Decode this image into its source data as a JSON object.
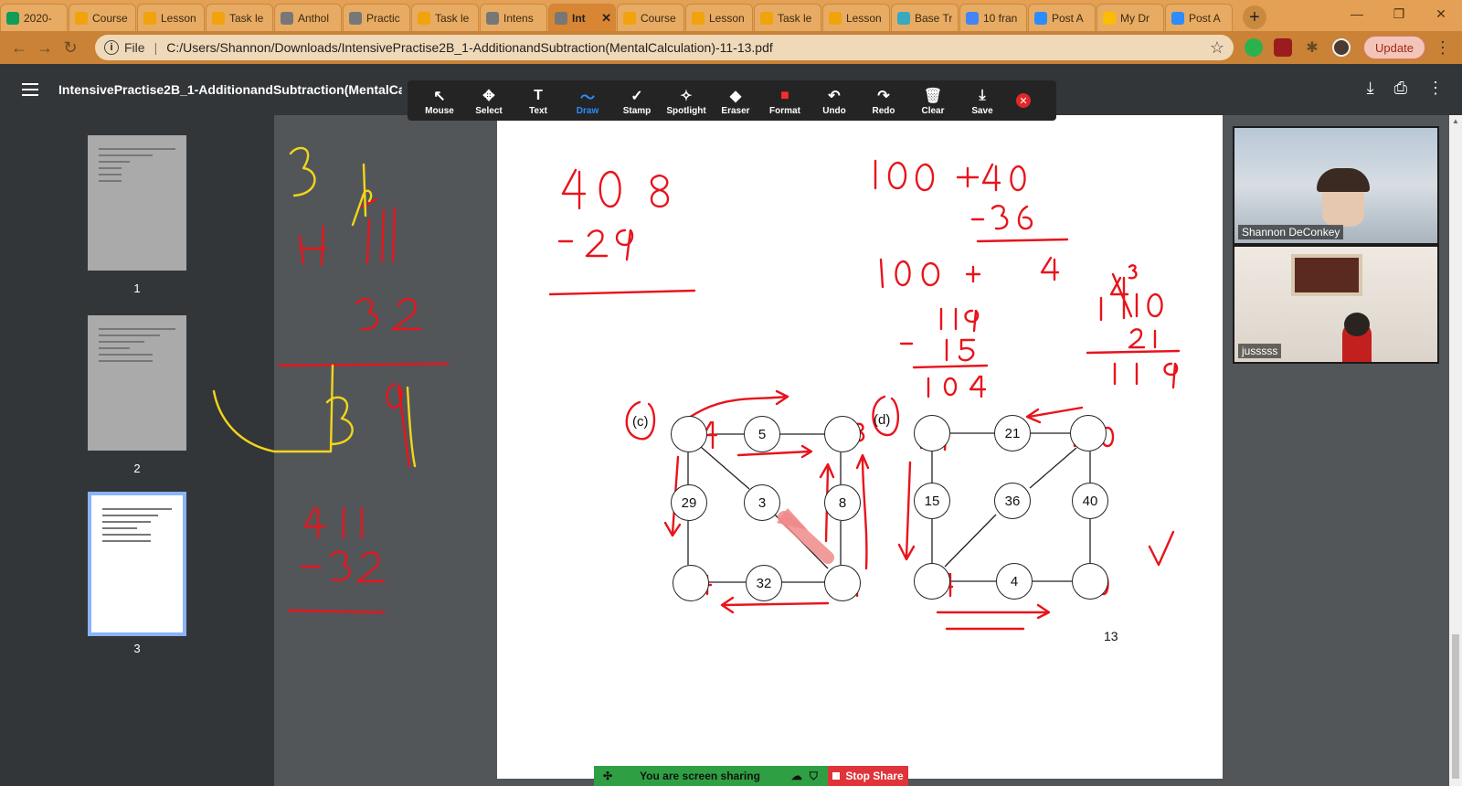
{
  "browser": {
    "tabs": [
      {
        "label": "2020-",
        "favicon": "sheets-icon",
        "color": "#0f9d58"
      },
      {
        "label": "Course",
        "favicon": "moodle-icon",
        "color": "#f0a30a"
      },
      {
        "label": "Lesson",
        "favicon": "moodle-icon",
        "color": "#f0a30a"
      },
      {
        "label": "Task le",
        "favicon": "moodle-icon",
        "color": "#f0a30a"
      },
      {
        "label": "Anthol",
        "favicon": "globe-icon",
        "color": "#777777"
      },
      {
        "label": "Practic",
        "favicon": "globe-icon",
        "color": "#777777"
      },
      {
        "label": "Task le",
        "favicon": "moodle-icon",
        "color": "#f0a30a"
      },
      {
        "label": "Intens",
        "favicon": "globe-icon",
        "color": "#777777"
      },
      {
        "label": "Int",
        "favicon": "globe-icon",
        "color": "#777777",
        "active": true
      },
      {
        "label": "Course",
        "favicon": "moodle-icon",
        "color": "#f0a30a"
      },
      {
        "label": "Lesson",
        "favicon": "moodle-icon",
        "color": "#f0a30a"
      },
      {
        "label": "Task le",
        "favicon": "moodle-icon",
        "color": "#f0a30a"
      },
      {
        "label": "Lesson",
        "favicon": "moodle-icon",
        "color": "#f0a30a"
      },
      {
        "label": "Base Tr",
        "favicon": "base-icon",
        "color": "#3aa8c1"
      },
      {
        "label": "10 fran",
        "favicon": "docs-icon",
        "color": "#4285f4"
      },
      {
        "label": "Post A",
        "favicon": "zoom-icon",
        "color": "#2d8cff"
      },
      {
        "label": "My Dr",
        "favicon": "drive-icon",
        "color": "#fbbc04"
      },
      {
        "label": "Post A",
        "favicon": "zoom-icon",
        "color": "#2d8cff"
      }
    ],
    "url_scheme": "File",
    "url": "C:/Users/Shannon/Downloads/IntensivePractise2B_1-AdditionandSubtraction(MentalCalculation)-11-13.pdf",
    "update_label": "Update"
  },
  "pdf": {
    "title": "IntensivePractise2B_1-AdditionandSubtraction(MentalCalcul",
    "thumbnails": [
      "1",
      "2",
      "3"
    ],
    "page_number": "13",
    "labels": {
      "c": "(c)",
      "d": "(d)"
    },
    "graph_c": [
      "5",
      "29",
      "3",
      "8",
      "32"
    ],
    "graph_d": [
      "21",
      "15",
      "36",
      "40",
      "4"
    ]
  },
  "annotation_toolbar": {
    "tools": [
      {
        "label": "Mouse",
        "icon": "cursor-icon",
        "glyph": "↖"
      },
      {
        "label": "Select",
        "icon": "move-icon",
        "glyph": "✥"
      },
      {
        "label": "Text",
        "icon": "text-icon",
        "glyph": "T"
      },
      {
        "label": "Draw",
        "icon": "draw-icon",
        "glyph": "〜",
        "selected": true
      },
      {
        "label": "Stamp",
        "icon": "check-icon",
        "glyph": "✓"
      },
      {
        "label": "Spotlight",
        "icon": "spotlight-icon",
        "glyph": "✧"
      },
      {
        "label": "Eraser",
        "icon": "eraser-icon",
        "glyph": "◆"
      },
      {
        "label": "Format",
        "icon": "format-icon",
        "glyph": "■"
      },
      {
        "label": "Undo",
        "icon": "undo-icon",
        "glyph": "↶"
      },
      {
        "label": "Redo",
        "icon": "redo-icon",
        "glyph": "↷"
      },
      {
        "label": "Clear",
        "icon": "trash-icon",
        "glyph": "🗑"
      },
      {
        "label": "Save",
        "icon": "save-icon",
        "glyph": "⤓"
      }
    ]
  },
  "video": {
    "participants": [
      {
        "name": "Shannon DeConkey"
      },
      {
        "name": "jusssss"
      }
    ]
  },
  "share_bar": {
    "status": "You are screen sharing",
    "stop_label": "Stop Share"
  },
  "colors": {
    "ink_red": "#e8141c",
    "ink_yellow": "#f2d51a",
    "active_tool": "#2d8cff"
  }
}
